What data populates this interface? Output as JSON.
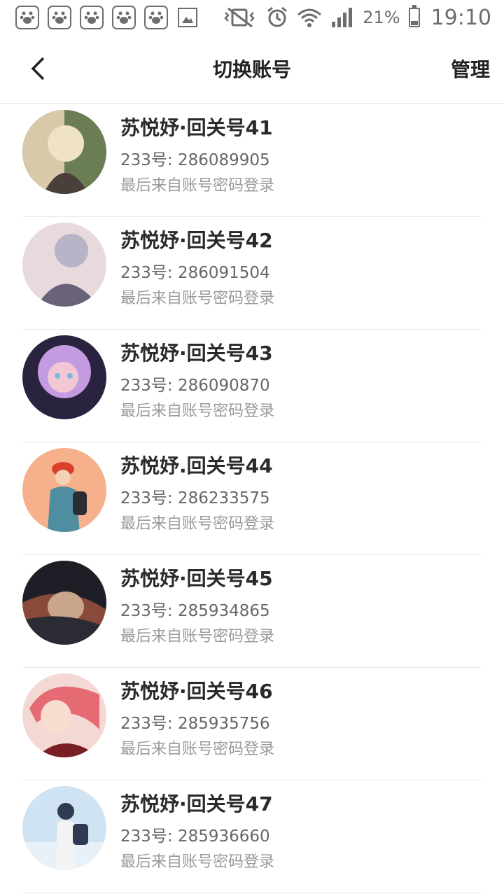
{
  "status_bar": {
    "battery_percent": "21%",
    "time": "19:10",
    "icons": [
      "baidu-paw-icon",
      "baidu-paw-icon",
      "baidu-paw-icon",
      "baidu-paw-icon",
      "baidu-paw-icon",
      "gallery-icon",
      "mute-vibrate-icon",
      "alarm-icon",
      "wifi-icon",
      "signal-icon",
      "battery-icon"
    ]
  },
  "nav": {
    "back_icon": "chevron-left-icon",
    "title": "切换账号",
    "manage_label": "管理"
  },
  "accounts": [
    {
      "name": "苏悦妤·回关号41",
      "id_line": "233号: 286089905",
      "login_line": "最后来自账号密码登录",
      "avatar_colors": [
        "#4a3f3a",
        "#d8c9a8",
        "#6a7d55"
      ]
    },
    {
      "name": "苏悦妤·回关号42",
      "id_line": "233号: 286091504",
      "login_line": "最后来自账号密码登录",
      "avatar_colors": [
        "#b8b4c8",
        "#6a6278",
        "#e7d9dc"
      ]
    },
    {
      "name": "苏悦妤·回关号43",
      "id_line": "233号: 286090870",
      "login_line": "最后来自账号密码登录",
      "avatar_colors": [
        "#c49ae0",
        "#78b8d8",
        "#f2c7d4"
      ]
    },
    {
      "name": "苏悦妤.回关号44",
      "id_line": "233号: 286233575",
      "login_line": "最后来自账号密码登录",
      "avatar_colors": [
        "#f6b08c",
        "#4f8ea0",
        "#d8402c"
      ]
    },
    {
      "name": "苏悦妤·回关号45",
      "id_line": "233号: 285934865",
      "login_line": "最后来自账号密码登录",
      "avatar_colors": [
        "#1d1e26",
        "#c9a58c",
        "#8a4a3a"
      ]
    },
    {
      "name": "苏悦妤·回关号46",
      "id_line": "233号: 285935756",
      "login_line": "最后来自账号密码登录",
      "avatar_colors": [
        "#f4d8d4",
        "#e66a73",
        "#7a1f26"
      ]
    },
    {
      "name": "苏悦妤·回关号47",
      "id_line": "233号: 285936660",
      "login_line": "最后来自账号密码登录",
      "avatar_colors": [
        "#cfe3f2",
        "#2f3b52",
        "#f3f3f3"
      ]
    }
  ]
}
